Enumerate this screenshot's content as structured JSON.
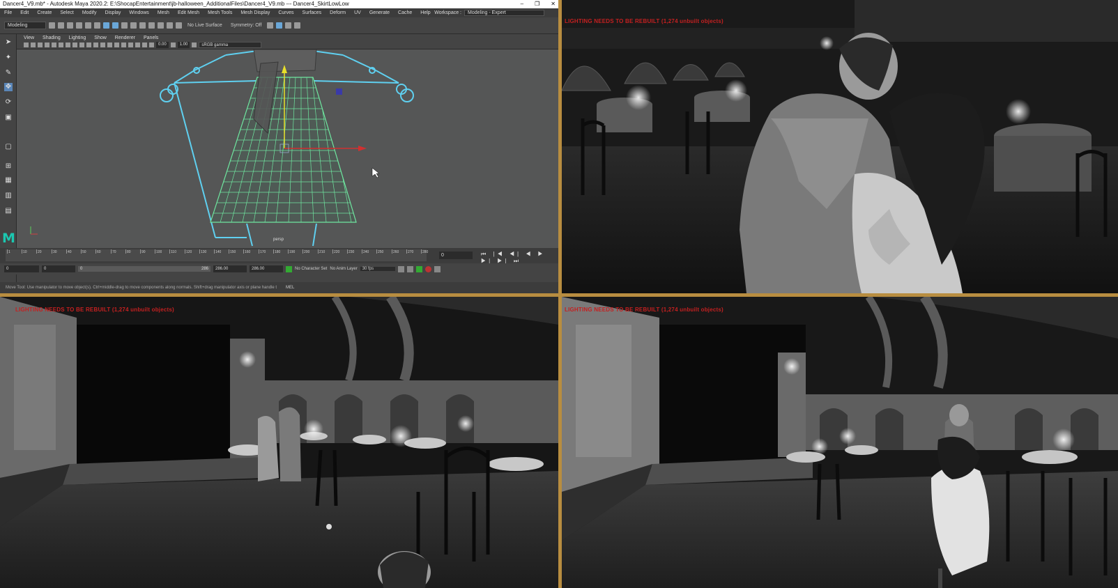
{
  "maya": {
    "title": "Dancer4_V9.mb* - Autodesk Maya 2020.2: E:\\ShocapEntertainment\\jb-halloween_AdditionalFiles\\Dancer4_V9.mb  ---  Dancer4_SkirtLowLow",
    "window_buttons": [
      "–",
      "❐",
      "✕"
    ],
    "menus": [
      "File",
      "Edit",
      "Create",
      "Select",
      "Modify",
      "Display",
      "Windows",
      "Mesh",
      "Edit Mesh",
      "Mesh Tools",
      "Mesh Display",
      "Curves",
      "Surfaces",
      "Deform",
      "UV",
      "Generate",
      "Cache",
      "Help"
    ],
    "workspace_label": "Workspace :",
    "workspace_value": "Modeling - Expert",
    "mode": "Modeling",
    "live_surface": "No Live Surface",
    "symmetry": "Symmetry: Off",
    "panel_menus": [
      "View",
      "Shading",
      "Lighting",
      "Show",
      "Renderer",
      "Panels"
    ],
    "field_a": "0.00",
    "field_b": "1.00",
    "color_space": "sRGB gamma",
    "camera": "persp",
    "time": {
      "ticks": [
        "1",
        "10",
        "20",
        "30",
        "40",
        "50",
        "60",
        "70",
        "80",
        "90",
        "100",
        "110",
        "120",
        "130",
        "140",
        "150",
        "160",
        "170",
        "180",
        "190",
        "200",
        "210",
        "220",
        "230",
        "240",
        "250",
        "260",
        "270",
        "280"
      ],
      "current_frame": "0",
      "playback": "⏮ |◀ ◀| ◀ ▶ ▶| ▶| ⏭"
    },
    "range": {
      "start": "0",
      "anim_start": "0",
      "slider_start": "0",
      "slider_end": "286",
      "end": "286.00",
      "anim_end": "286.00",
      "character_set": "No Character Set",
      "anim_layer": "No Anim Layer",
      "fps": "30 fps"
    },
    "help_text": "Move Tool: Use manipulator to move object(s). Ctrl+middle-drag to move components along normals. Shift+drag manipulator axis or plane handle t",
    "mel_label": "MEL"
  },
  "panels": {
    "top_right_warning": "LIGHTING NEEDS TO BE REBUILT (1,274 unbuilt objects)",
    "bottom_left_warning": "LIGHTING NEEDS TO BE REBUILT (1,274 unbuilt objects)",
    "bottom_right_warning": "LIGHTING NEEDS TO BE REBUILT (1,274 unbuilt objects)"
  },
  "colors": {
    "divider": "#b88d40",
    "wireframe": "#6fe7a0",
    "skeleton": "#5fd0f0",
    "warning": "#c42020"
  }
}
